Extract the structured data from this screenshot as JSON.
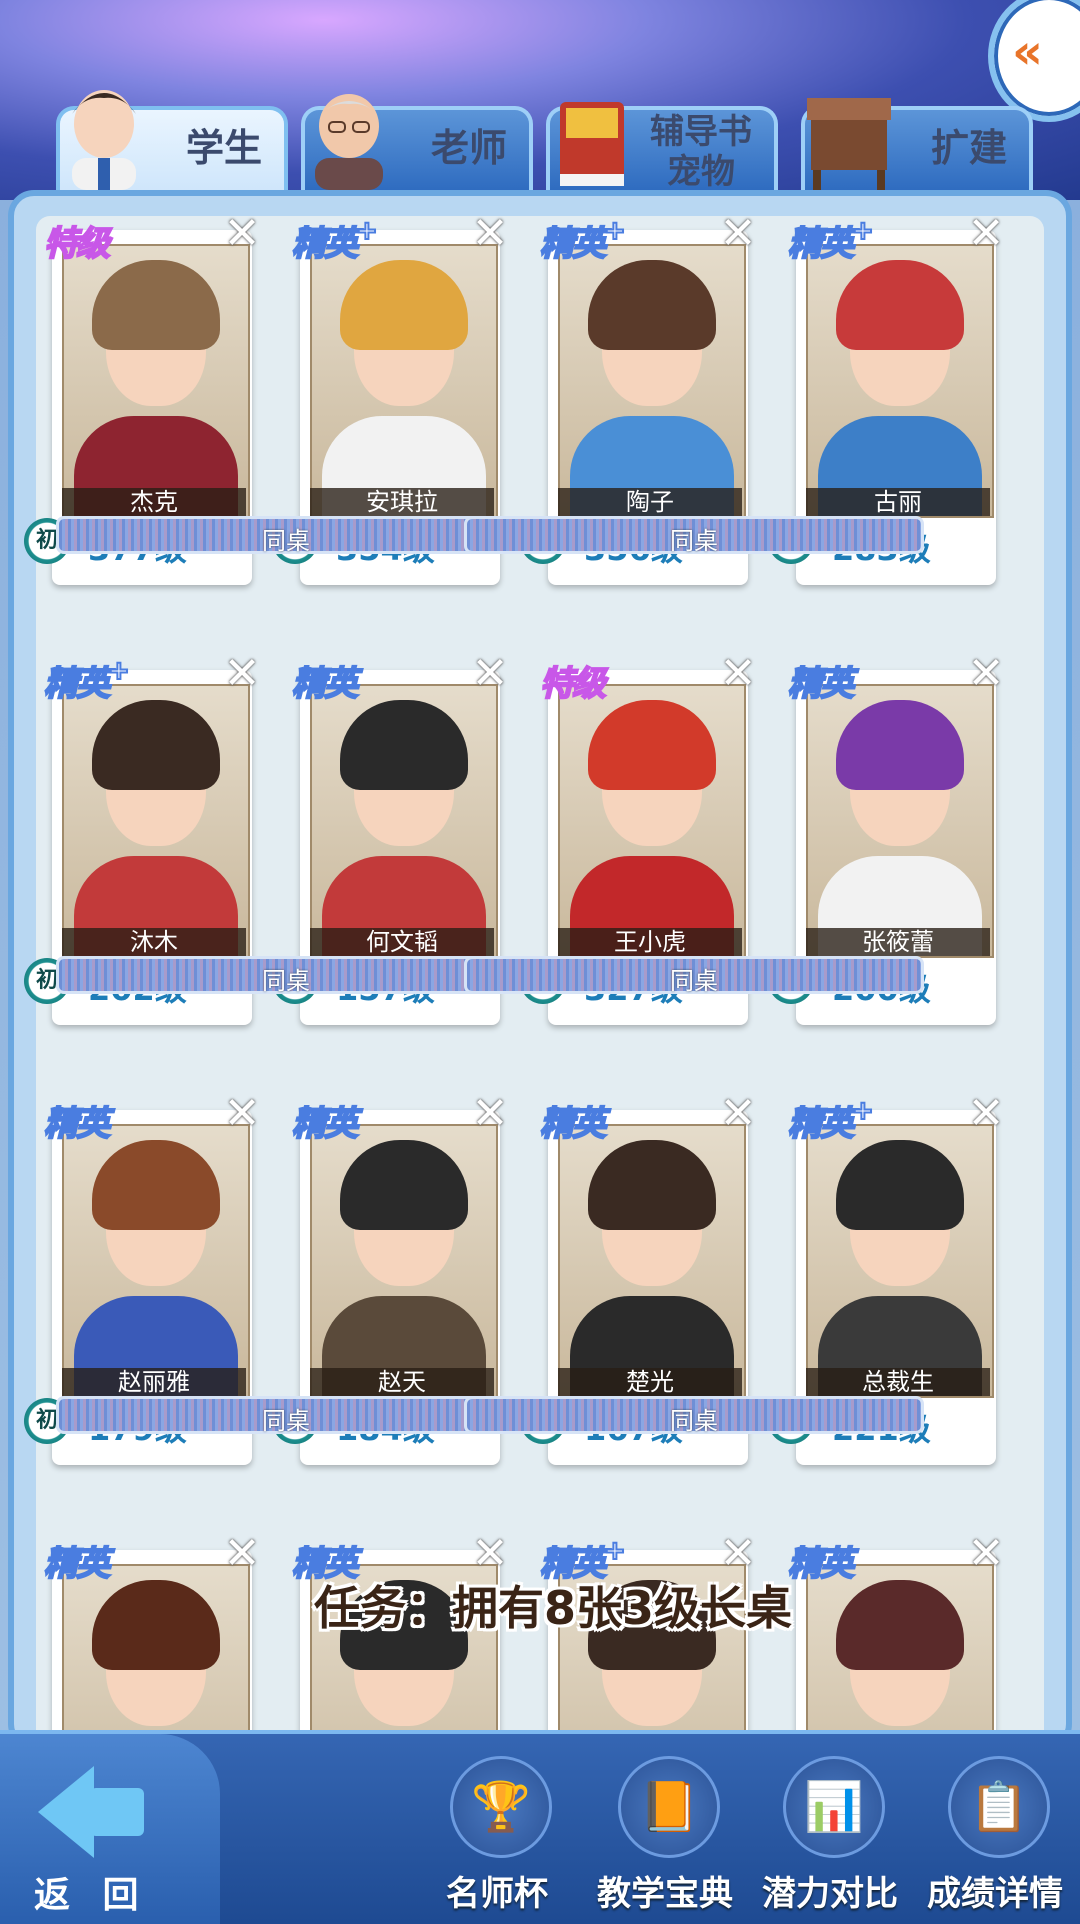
{
  "tabs": [
    {
      "label": "学生",
      "active": true,
      "icon": "student-avatar-icon"
    },
    {
      "label": "老师",
      "active": false,
      "icon": "teacher-avatar-icon"
    },
    {
      "label": "辅导书\n宠物",
      "active": false,
      "icon": "book-icon"
    },
    {
      "label": "扩建",
      "active": false,
      "icon": "desk-icon"
    }
  ],
  "desk_label": "同桌",
  "rank_label": "初",
  "students": [
    {
      "name": "杰克",
      "level": "377级",
      "tier": "特级",
      "plus": false,
      "hair": "#8b6a4a",
      "body": "#8e2430"
    },
    {
      "name": "安琪拉",
      "level": "354级",
      "tier": "精英",
      "plus": true,
      "hair": "#e0a640",
      "body": "#f2f2f2"
    },
    {
      "name": "陶子",
      "level": "356级",
      "tier": "精英",
      "plus": true,
      "hair": "#5a3a2a",
      "body": "#4a8fd6"
    },
    {
      "name": "古丽",
      "level": "283级",
      "tier": "精英",
      "plus": true,
      "hair": "#c73a3a",
      "body": "#3d7fc8"
    },
    {
      "name": "沐木",
      "level": "202级",
      "tier": "精英",
      "plus": true,
      "hair": "#3a2a22",
      "body": "#c23a3a"
    },
    {
      "name": "何文韬",
      "level": "157级",
      "tier": "精英",
      "plus": false,
      "hair": "#2a2a2a",
      "body": "#c23a3a"
    },
    {
      "name": "王小虎",
      "level": "327级",
      "tier": "特级",
      "plus": false,
      "hair": "#d23a2a",
      "body": "#c2282a"
    },
    {
      "name": "张筱蕾",
      "level": "200级",
      "tier": "精英",
      "plus": false,
      "hair": "#7a3aa8",
      "body": "#f2f2f2"
    },
    {
      "name": "赵丽雅",
      "level": "179级",
      "tier": "精英",
      "plus": false,
      "hair": "#8a4a2a",
      "body": "#3a5ab8"
    },
    {
      "name": "赵天",
      "level": "184级",
      "tier": "精英",
      "plus": false,
      "hair": "#2a2a2a",
      "body": "#5a4a3a"
    },
    {
      "name": "楚光",
      "level": "167级",
      "tier": "精英",
      "plus": false,
      "hair": "#3a2a22",
      "body": "#2a2a2a"
    },
    {
      "name": "总裁生",
      "level": "221级",
      "tier": "精英",
      "plus": true,
      "hair": "#2a2a2a",
      "body": "#3a3a3a"
    },
    {
      "name": "",
      "level": "",
      "tier": "精英",
      "plus": false,
      "hair": "#5a2a1a",
      "body": "#c23a3a"
    },
    {
      "name": "",
      "level": "",
      "tier": "精英",
      "plus": false,
      "hair": "#2a2a2a",
      "body": "#3a3a3a"
    },
    {
      "name": "",
      "level": "",
      "tier": "精英",
      "plus": true,
      "hair": "#3a2a22",
      "body": "#3a3a3a"
    },
    {
      "name": "",
      "level": "",
      "tier": "精英",
      "plus": false,
      "hair": "#5a2a2a",
      "body": "#c23a3a"
    }
  ],
  "task": "任务：拥有8张3级长桌",
  "bottom": {
    "back": "返 回",
    "buttons": [
      {
        "label": "名师杯",
        "icon": "trophy-icon",
        "glyph": "🏆"
      },
      {
        "label": "教学宝典",
        "icon": "book-icon",
        "glyph": "📙"
      },
      {
        "label": "潜力对比",
        "icon": "chart-books-icon",
        "glyph": "📊"
      },
      {
        "label": "成绩详情",
        "icon": "report-icon",
        "glyph": "📋"
      }
    ]
  }
}
